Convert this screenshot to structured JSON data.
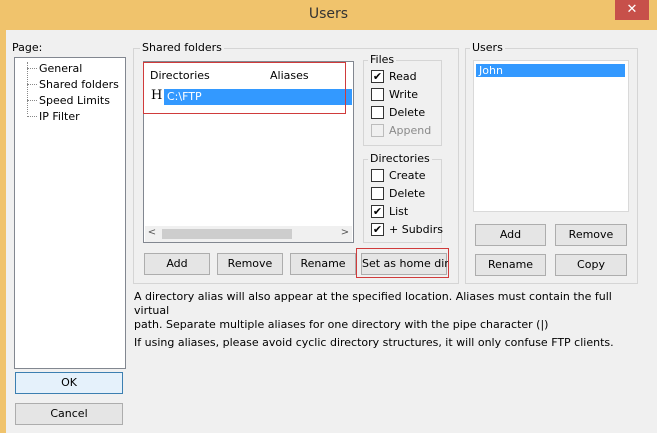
{
  "window": {
    "title": "Users",
    "close_glyph": "✕"
  },
  "page_panel": {
    "label": "Page:",
    "items": [
      "General",
      "Shared folders",
      "Speed Limits",
      "IP Filter"
    ]
  },
  "shared_folders": {
    "legend": "Shared folders",
    "columns": [
      "Directories",
      "Aliases"
    ],
    "rows": [
      {
        "flag": "H",
        "directory": "C:\\FTP",
        "alias": ""
      }
    ],
    "scroll_left": "<",
    "scroll_right": ">",
    "buttons": {
      "add": "Add",
      "remove": "Remove",
      "rename": "Rename",
      "home": "Set as home dir"
    }
  },
  "files": {
    "legend": "Files",
    "items": [
      {
        "label": "Read",
        "checked": true,
        "enabled": true
      },
      {
        "label": "Write",
        "checked": false,
        "enabled": true
      },
      {
        "label": "Delete",
        "checked": false,
        "enabled": true
      },
      {
        "label": "Append",
        "checked": false,
        "enabled": false
      }
    ]
  },
  "directories": {
    "legend": "Directories",
    "items": [
      {
        "label": "Create",
        "checked": false,
        "enabled": true
      },
      {
        "label": "Delete",
        "checked": false,
        "enabled": true
      },
      {
        "label": "List",
        "checked": true,
        "enabled": true
      },
      {
        "label": "+ Subdirs",
        "checked": true,
        "enabled": true
      }
    ]
  },
  "users": {
    "legend": "Users",
    "list": [
      "John"
    ],
    "buttons": {
      "add": "Add",
      "remove": "Remove",
      "rename": "Rename",
      "copy": "Copy"
    }
  },
  "info": {
    "line1": "A directory alias will also appear at the specified location. Aliases must contain the full virtual",
    "line2": "path. Separate multiple aliases for one directory with the pipe character (|)",
    "line3": "If using aliases, please avoid cyclic directory structures, it will only confuse FTP clients."
  },
  "footer": {
    "ok": "OK",
    "cancel": "Cancel"
  },
  "colors": {
    "titlebar": "#f0c36c",
    "selection": "#3399ff",
    "highlight_box": "#d03b3b",
    "close": "#c7504a"
  }
}
